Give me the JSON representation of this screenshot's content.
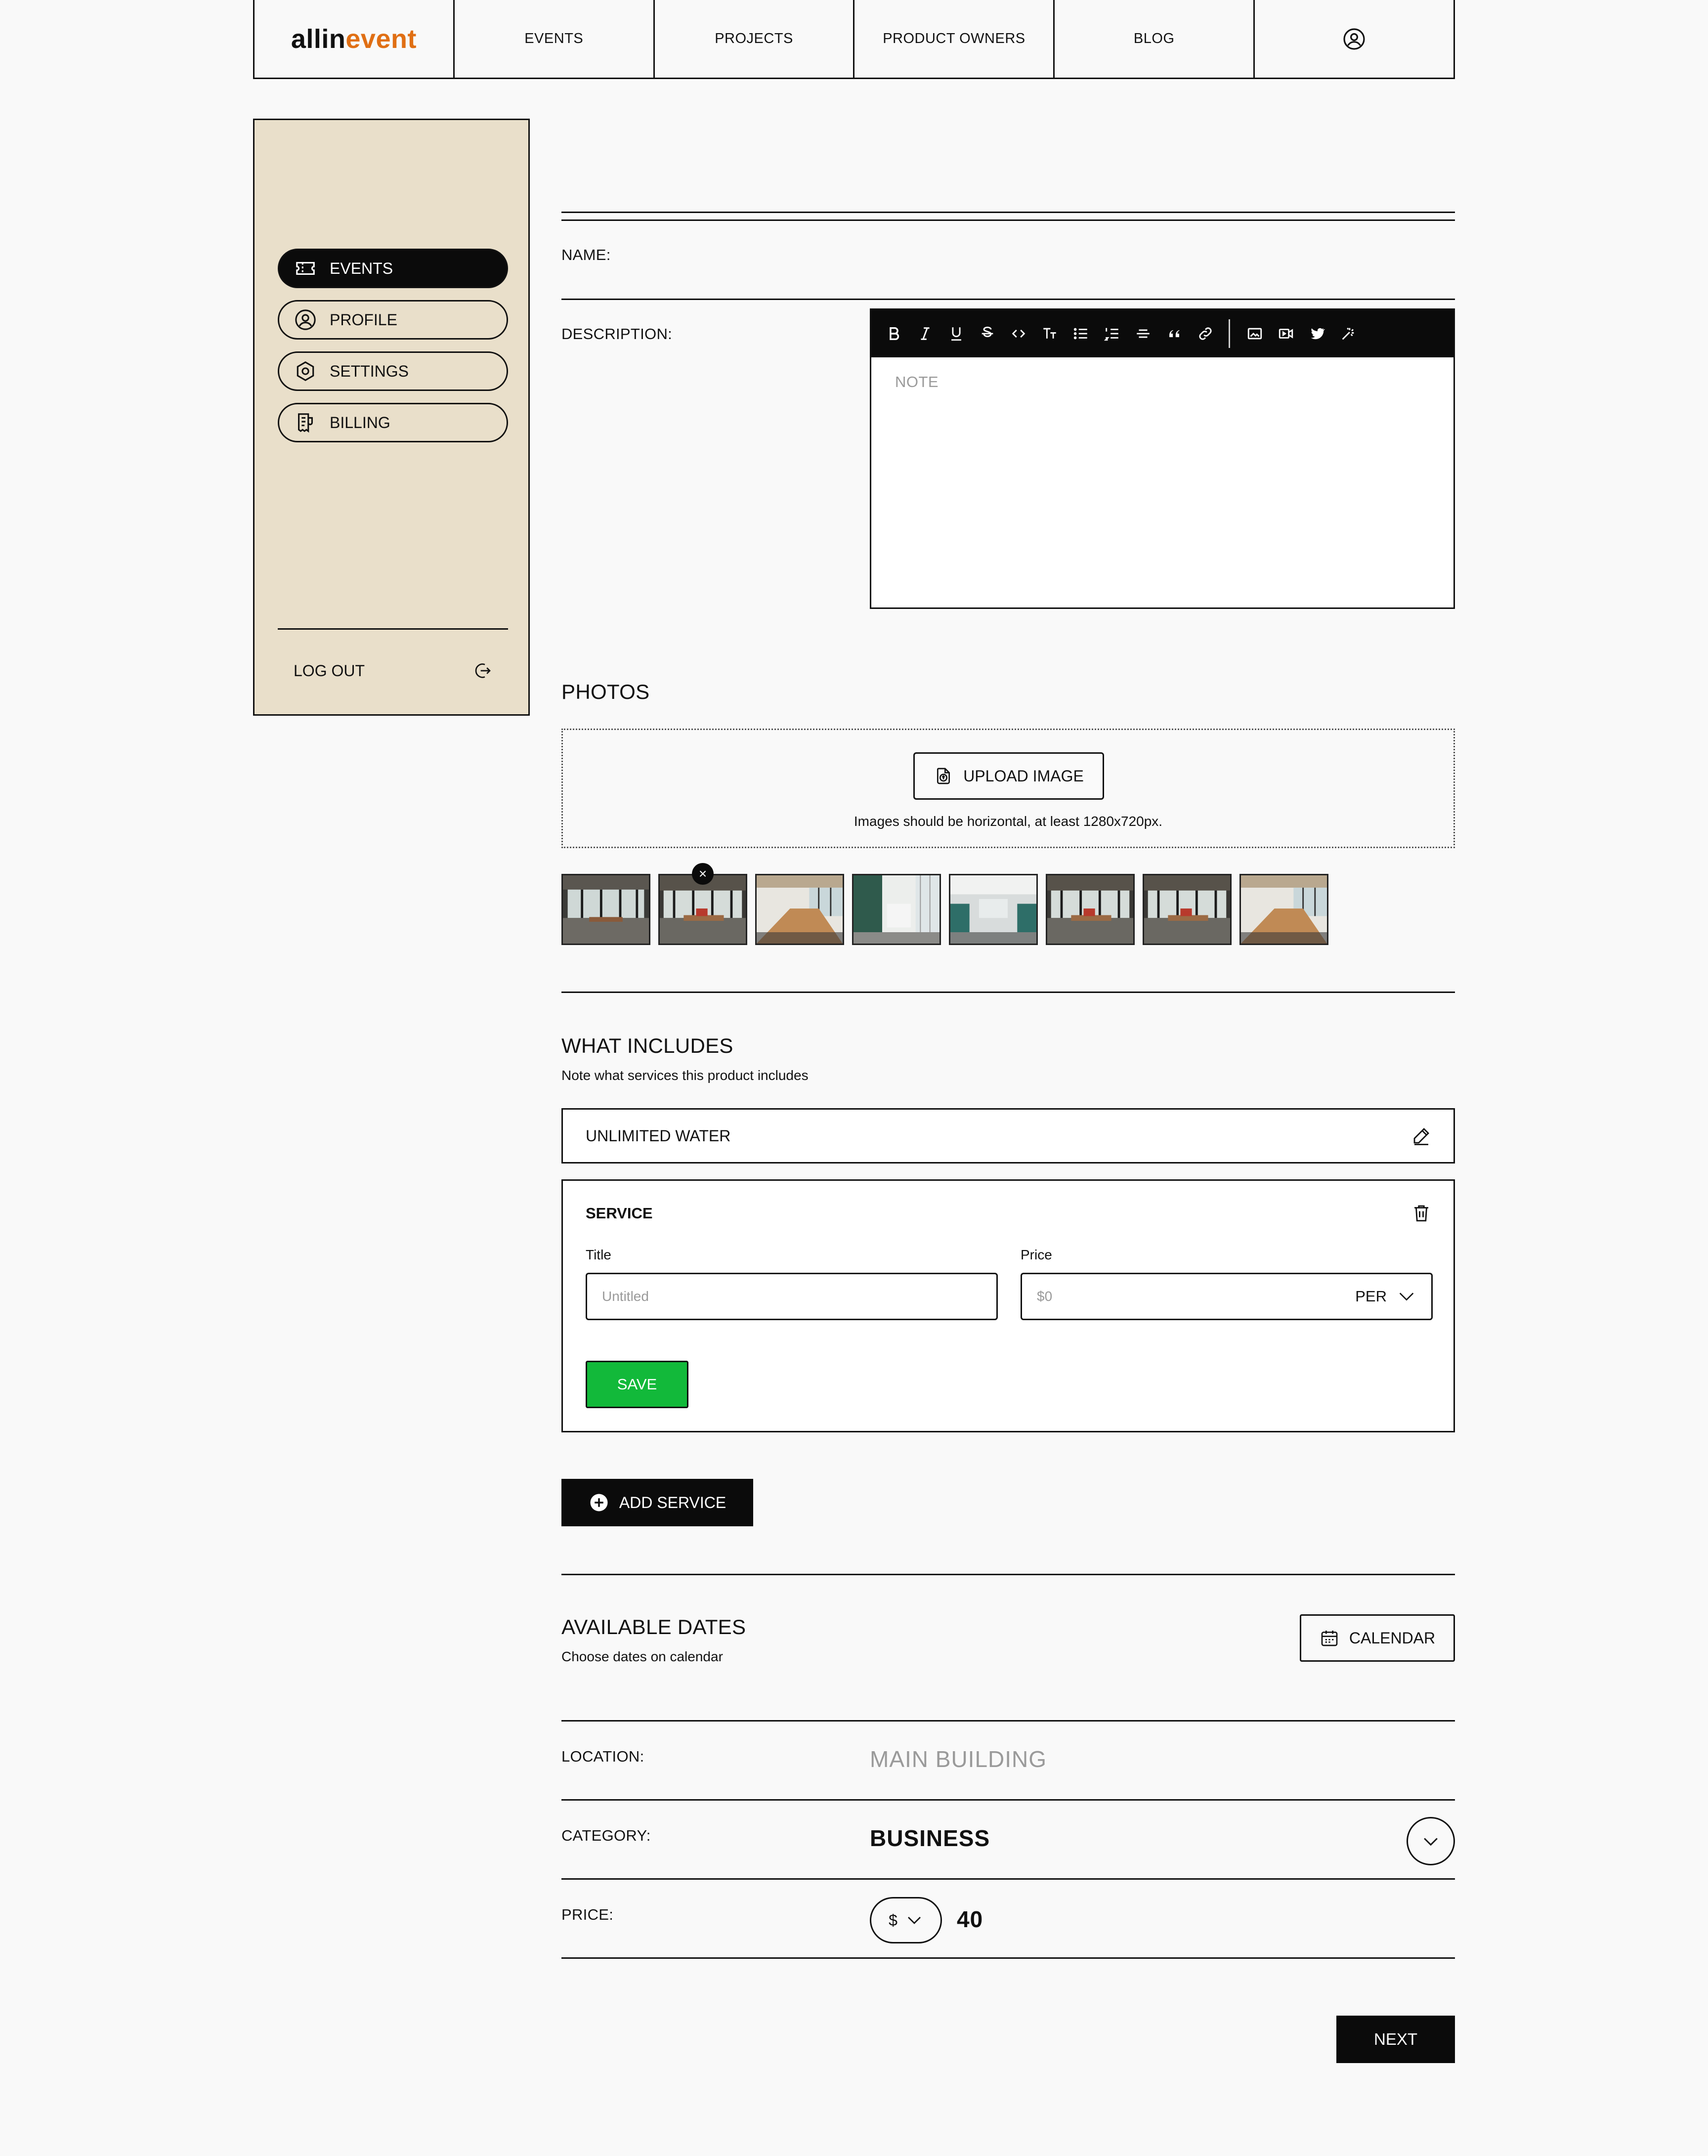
{
  "header": {
    "logo_part1": "allin",
    "logo_part2": "event",
    "nav": [
      "EVENTS",
      "PROJECTS",
      "PRODUCT OWNERS",
      "BLOG"
    ],
    "account_icon": "user-circle-icon"
  },
  "sidebar": {
    "items": [
      {
        "label": "EVENTS",
        "icon": "ticket-icon",
        "active": true
      },
      {
        "label": "PROFILE",
        "icon": "user-circle-icon",
        "active": false
      },
      {
        "label": "SETTINGS",
        "icon": "gear-icon",
        "active": false
      },
      {
        "label": "BILLING",
        "icon": "receipt-icon",
        "active": false
      }
    ],
    "logout_label": "LOG OUT"
  },
  "form": {
    "name_label": "NAME:",
    "description_label": "DESCRIPTION:",
    "editor": {
      "placeholder": "NOTE",
      "tools": [
        "bold",
        "italic",
        "underline",
        "strikethrough",
        "code",
        "text-size",
        "bullet-list",
        "numbered-list",
        "horizontal-rule",
        "quote",
        "link",
        "image",
        "video",
        "twitter",
        "magic"
      ]
    },
    "photos": {
      "title": "PHOTOS",
      "upload_label": "UPLOAD IMAGE",
      "hint": "Images should be horizontal, at least 1280x720px.",
      "thumb_count": 8,
      "remove_glyph": "×"
    },
    "includes": {
      "title": "WHAT INCLUDES",
      "subtitle": "Note what services this product includes",
      "existing_item": "UNLIMITED WATER",
      "service": {
        "heading": "SERVICE",
        "title_label": "Title",
        "title_placeholder": "Untitled",
        "price_label": "Price",
        "price_placeholder": "$0",
        "per_label": "PER",
        "save_label": "SAVE"
      },
      "add_label": "ADD SERVICE"
    },
    "dates": {
      "title": "AVAILABLE DATES",
      "subtitle": "Choose dates on calendar",
      "calendar_label": "CALENDAR"
    },
    "location_label": "LOCATION:",
    "location_value": "MAIN BUILDING",
    "category_label": "CATEGORY:",
    "category_value": "BUSINESS",
    "price_label": "PRICE:",
    "price_currency": "$",
    "price_value": "40",
    "next_label": "NEXT"
  },
  "colors": {
    "background": "#f9f9f9",
    "sidebar_bg": "#e9dfca",
    "accent_orange": "#e06f14",
    "save_green": "#12b93a",
    "dark": "#0b0b0b",
    "muted": "#9a9a9a"
  }
}
